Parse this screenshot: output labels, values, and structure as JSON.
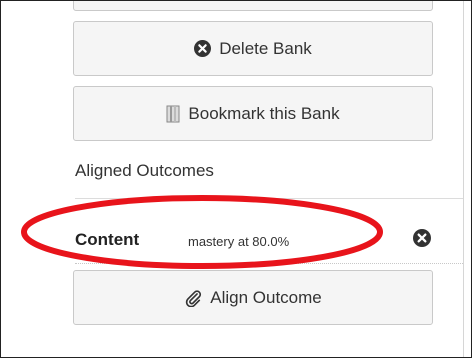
{
  "buttons": {
    "delete_label": "Delete Bank",
    "bookmark_label": "Bookmark this Bank",
    "align_label": "Align Outcome"
  },
  "aligned_outcomes": {
    "heading": "Aligned Outcomes",
    "items": [
      {
        "name": "Content",
        "mastery": "mastery at 80.0%"
      }
    ]
  },
  "icons": {
    "delete": "x-circle-icon",
    "bookmark": "bookmark-icon",
    "align": "paperclip-icon",
    "remove_outcome": "x-circle-icon"
  },
  "colors": {
    "highlight": "#e8141b",
    "button_bg": "#f5f5f5",
    "icon": "#333333"
  }
}
